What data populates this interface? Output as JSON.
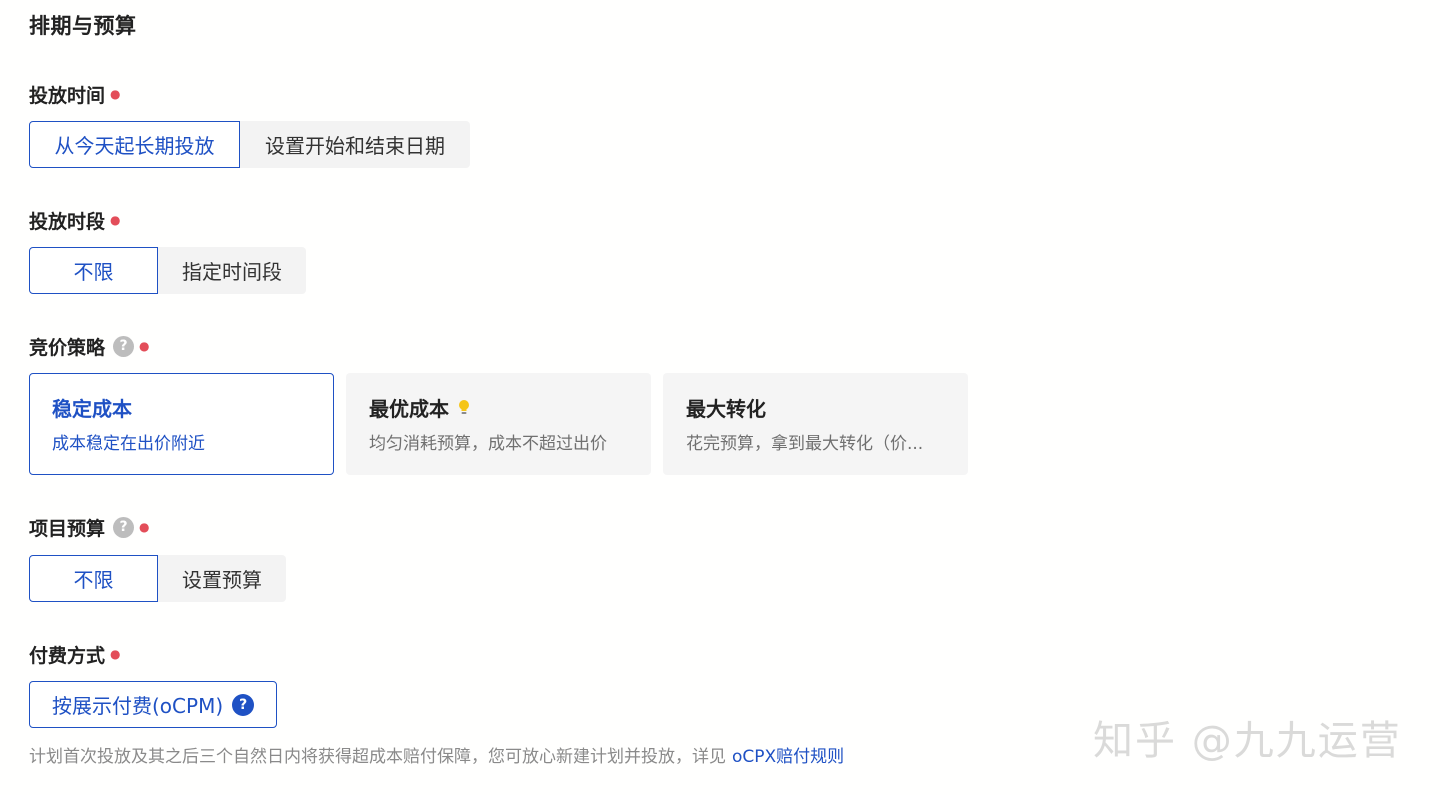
{
  "section": {
    "title": "排期与预算"
  },
  "schedule": {
    "label": "投放时间",
    "options": [
      "从今天起长期投放",
      "设置开始和结束日期"
    ],
    "selected": 0
  },
  "time_slot": {
    "label": "投放时段",
    "options": [
      "不限",
      "指定时间段"
    ],
    "selected": 0
  },
  "bid_strategy": {
    "label": "竞价策略",
    "cards": [
      {
        "title": "稳定成本",
        "desc": "成本稳定在出价附近",
        "icon": ""
      },
      {
        "title": "最优成本",
        "desc": "均匀消耗预算，成本不超过出价",
        "icon": "lightbulb-icon"
      },
      {
        "title": "最大转化",
        "desc": "花完预算，拿到最大转化（价...",
        "icon": ""
      }
    ],
    "selected": 0
  },
  "budget": {
    "label": "项目预算",
    "options": [
      "不限",
      "设置预算"
    ],
    "selected": 0
  },
  "payment": {
    "label": "付费方式",
    "button_label": "按展示付费(oCPM)",
    "help_icon": "question-icon"
  },
  "note": {
    "text": "计划首次投放及其之后三个自然日内将获得超成本赔付保障，您可放心新建计划并投放，详见",
    "link": "oCPX赔付规则"
  },
  "watermark": "知乎 @九九运营",
  "colors": {
    "accent": "#1f51c4",
    "required": "#e34d59",
    "muted": "#8a8a8a"
  }
}
